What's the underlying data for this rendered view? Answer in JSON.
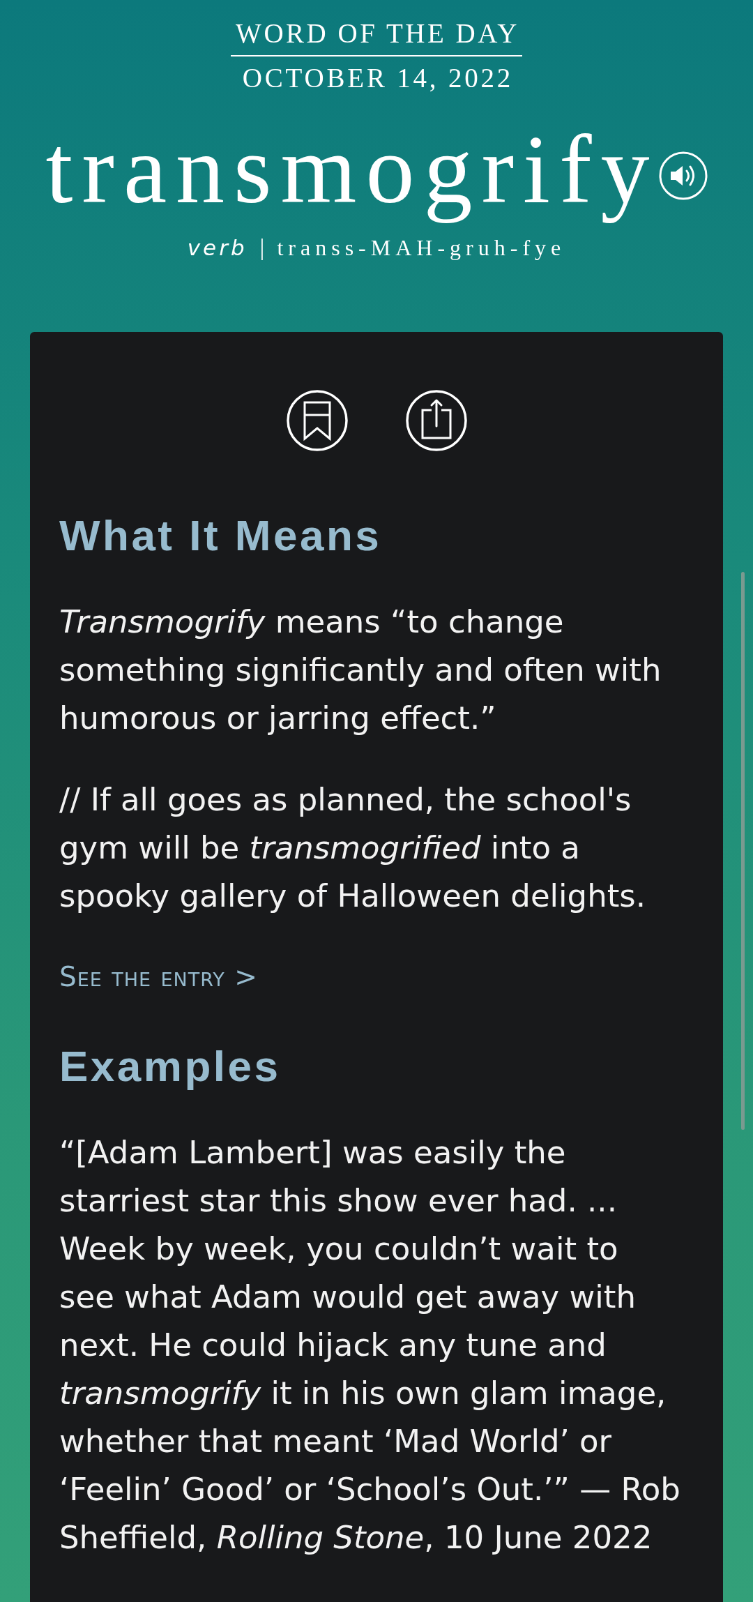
{
  "header": {
    "eyebrow": "WORD OF THE DAY",
    "date": "OCTOBER 14, 2022",
    "word": "transmogrify",
    "part_of_speech": "verb",
    "separator": "|",
    "pronunciation": "transs-MAH-gruh-fye"
  },
  "sections": [
    {
      "heading": "What It Means",
      "paragraphs": [
        {
          "lines": [
            "*Transmogrify* means “to change",
            "something significantly and often with",
            "humorous or jarring effect.”"
          ]
        },
        {
          "lines": [
            "// If all goes as planned, the school's",
            "gym will be *transmogrified* into a",
            "spooky gallery of Halloween delights."
          ]
        }
      ],
      "link": "See the entry >"
    },
    {
      "heading": "Examples",
      "paragraphs": [
        {
          "lines": [
            "“[Adam Lambert] was easily the",
            "starriest star this show ever had. ...",
            "Week by week, you couldn’t wait to",
            "see what Adam would get away with",
            "next. He could hijack any tune and",
            "*transmogrify* it in his own glam image,",
            "whether that meant ‘Mad World’ or",
            "‘Feelin’ Good’ or ‘School’s Out.’” — Rob",
            "Sheffield, *Rolling Stone*, 10 June 2022"
          ]
        }
      ]
    }
  ]
}
